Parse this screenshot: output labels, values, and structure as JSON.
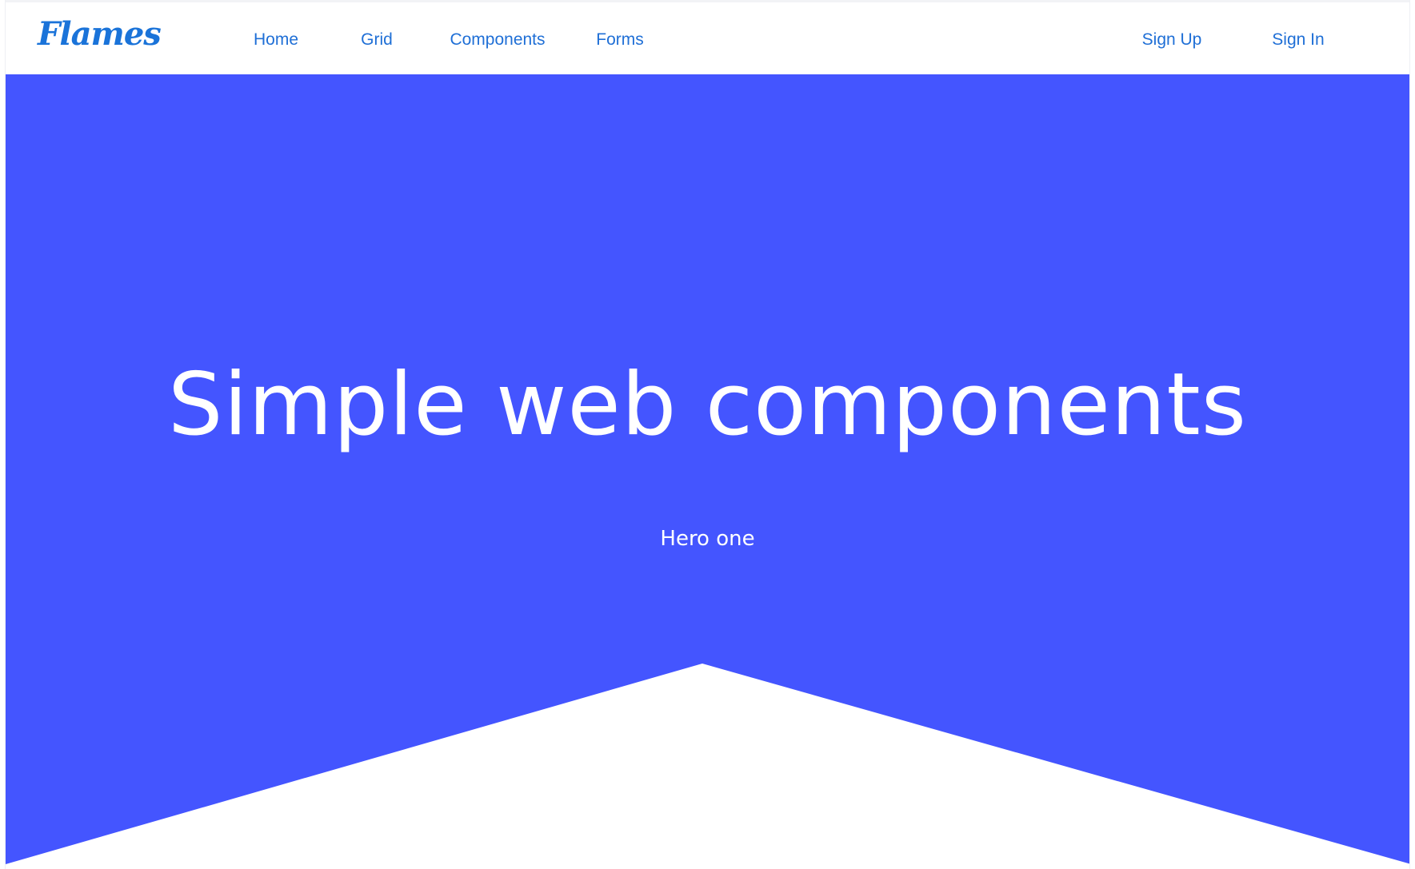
{
  "brand": {
    "logo_text": "Flames",
    "logo_color": "#1a73d9"
  },
  "nav": {
    "primary": [
      {
        "label": "Home",
        "active": true
      },
      {
        "label": "Grid",
        "active": false
      },
      {
        "label": "Components",
        "active": false
      },
      {
        "label": "Forms",
        "active": false
      }
    ],
    "auth": {
      "sign_up": "Sign Up",
      "sign_in": "Sign In"
    },
    "link_color": "#1f6fd6",
    "active_indicator_color": "#2aa7e8"
  },
  "hero": {
    "title": "Simple web components",
    "subtitle": "Hero one",
    "background_color": "#4455ff",
    "text_color": "#ffffff"
  }
}
